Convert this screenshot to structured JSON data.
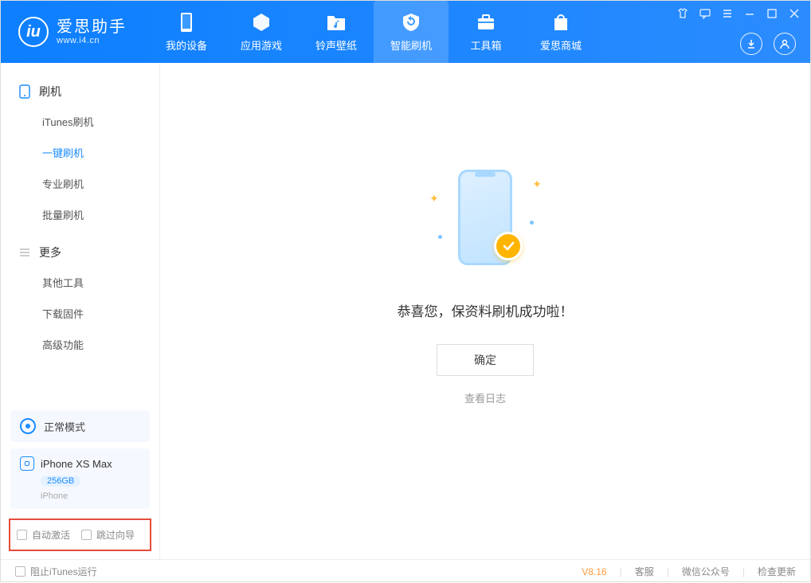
{
  "app": {
    "title": "爱思助手",
    "subtitle": "www.i4.cn"
  },
  "tabs": {
    "device": "我的设备",
    "apps": "应用游戏",
    "ringtone": "铃声壁纸",
    "flash": "智能刷机",
    "toolbox": "工具箱",
    "store": "爱思商城"
  },
  "sidebar": {
    "section_flash": "刷机",
    "items": {
      "itunes": "iTunes刷机",
      "oneclick": "一键刷机",
      "pro": "专业刷机",
      "batch": "批量刷机"
    },
    "section_more": "更多",
    "more": {
      "other": "其他工具",
      "firmware": "下载固件",
      "advanced": "高级功能"
    }
  },
  "mode": {
    "label": "正常模式"
  },
  "device": {
    "name": "iPhone XS Max",
    "capacity": "256GB",
    "type": "iPhone"
  },
  "options": {
    "auto_activate": "自动激活",
    "skip_guide": "跳过向导"
  },
  "main": {
    "message": "恭喜您，保资料刷机成功啦！",
    "ok": "确定",
    "view_log": "查看日志"
  },
  "footer": {
    "block_itunes": "阻止iTunes运行",
    "version": "V8.16",
    "support": "客服",
    "wechat": "微信公众号",
    "update": "检查更新"
  }
}
